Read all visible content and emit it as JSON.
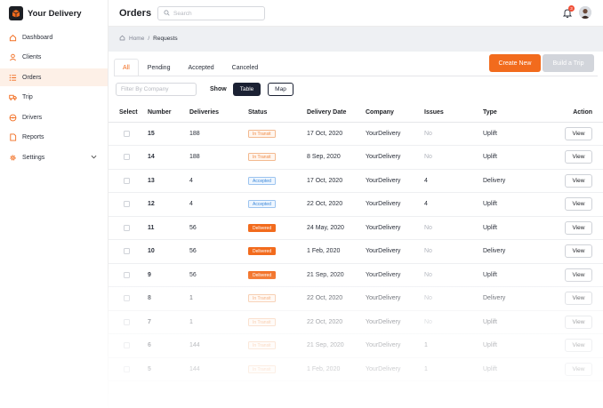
{
  "app": {
    "brand_name": "Your Delivery"
  },
  "sidebar": {
    "items": [
      {
        "label": "Dashboard",
        "icon": "home-icon"
      },
      {
        "label": "Clients",
        "icon": "user-icon"
      },
      {
        "label": "Orders",
        "icon": "list-icon",
        "active": true
      },
      {
        "label": "Trip",
        "icon": "truck-icon"
      },
      {
        "label": "Drivers",
        "icon": "steering-wheel-icon"
      },
      {
        "label": "Reports",
        "icon": "document-icon"
      },
      {
        "label": "Settings",
        "icon": "gear-icon",
        "expandable": true
      }
    ]
  },
  "header": {
    "title": "Orders",
    "search_placeholder": "Search",
    "notification_count": "3"
  },
  "breadcrumb": {
    "home": "Home",
    "separator": "/",
    "current": "Requests"
  },
  "tabs": [
    {
      "label": "All",
      "active": true
    },
    {
      "label": "Pending"
    },
    {
      "label": "Accepted"
    },
    {
      "label": "Canceled"
    }
  ],
  "actions": {
    "create_label": "Create New",
    "build_label": "Build a Trip"
  },
  "filters": {
    "company_placeholder": "Filter By Company",
    "show_label": "Show",
    "table_label": "Table",
    "map_label": "Map"
  },
  "table": {
    "columns": [
      "Select",
      "Number",
      "Deliveries",
      "Status",
      "Delivery Date",
      "Company",
      "Issues",
      "Type",
      "Action"
    ],
    "view_label": "View",
    "rows": [
      {
        "number": "15",
        "deliveries": "188",
        "status": "In Transit",
        "status_kind": "transit",
        "date": "17 Oct, 2020",
        "company": "YourDelivery",
        "issues": "No",
        "type": "Uplift"
      },
      {
        "number": "14",
        "deliveries": "188",
        "status": "In Transit",
        "status_kind": "transit",
        "date": "8 Sep, 2020",
        "company": "YourDelivery",
        "issues": "No",
        "type": "Uplift"
      },
      {
        "number": "13",
        "deliveries": "4",
        "status": "Accepted",
        "status_kind": "accepted",
        "date": "17 Oct, 2020",
        "company": "YourDelivery",
        "issues": "4",
        "type": "Delivery"
      },
      {
        "number": "12",
        "deliveries": "4",
        "status": "Accepted",
        "status_kind": "accepted",
        "date": "22 Oct, 2020",
        "company": "YourDelivery",
        "issues": "4",
        "type": "Uplift"
      },
      {
        "number": "11",
        "deliveries": "56",
        "status": "Delivered",
        "status_kind": "delivered",
        "date": "24 May, 2020",
        "company": "YourDelivery",
        "issues": "No",
        "type": "Uplift"
      },
      {
        "number": "10",
        "deliveries": "56",
        "status": "Delivered",
        "status_kind": "delivered",
        "date": "1 Feb, 2020",
        "company": "YourDelivery",
        "issues": "No",
        "type": "Delivery"
      },
      {
        "number": "9",
        "deliveries": "56",
        "status": "Delivered",
        "status_kind": "delivered",
        "date": "21 Sep, 2020",
        "company": "YourDelivery",
        "issues": "No",
        "type": "Uplift"
      },
      {
        "number": "8",
        "deliveries": "1",
        "status": "In Transit",
        "status_kind": "transit",
        "date": "22 Oct, 2020",
        "company": "YourDelivery",
        "issues": "No",
        "type": "Delivery"
      },
      {
        "number": "7",
        "deliveries": "1",
        "status": "In Transit",
        "status_kind": "transit",
        "date": "22 Oct, 2020",
        "company": "YourDelivery",
        "issues": "No",
        "type": "Uplift"
      },
      {
        "number": "6",
        "deliveries": "144",
        "status": "In Transit",
        "status_kind": "transit",
        "date": "21 Sep, 2020",
        "company": "YourDelivery",
        "issues": "1",
        "type": "Uplift"
      },
      {
        "number": "5",
        "deliveries": "144",
        "status": "In Transit",
        "status_kind": "transit",
        "date": "1 Feb, 2020",
        "company": "YourDelivery",
        "issues": "1",
        "type": "Uplift"
      }
    ]
  },
  "colors": {
    "accent": "#f26b1d",
    "dark": "#1b2133",
    "accepted": "#3a86d8"
  }
}
